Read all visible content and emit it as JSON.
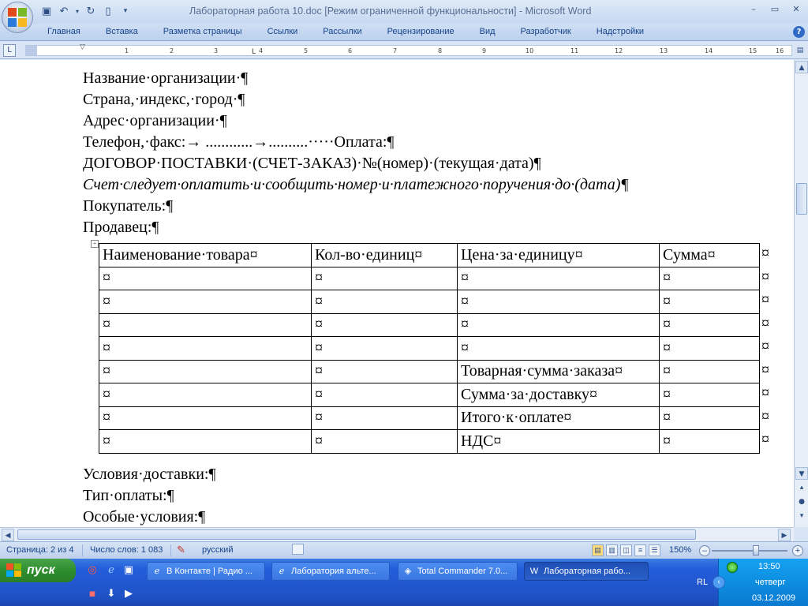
{
  "window": {
    "title": "Лабораторная работа 10.doc [Режим ограниченной функциональности]  -  Microsoft Word",
    "minimize": "–",
    "restore": "▭",
    "close": "✕"
  },
  "ribbon": {
    "tabs": [
      "Главная",
      "Вставка",
      "Разметка страницы",
      "Ссылки",
      "Рассылки",
      "Рецензирование",
      "Вид",
      "Разработчик",
      "Надстройки"
    ],
    "help": "?"
  },
  "ruler": {
    "numbers": [
      "1",
      "2",
      "3",
      "4",
      "5",
      "6",
      "7",
      "8",
      "9",
      "10",
      "11",
      "12",
      "13",
      "14",
      "15",
      "16"
    ]
  },
  "document": {
    "lines": [
      "Название·организации·¶",
      "Страна,·индекс,·город·¶",
      "Адрес·организации·¶",
      "Телефон,·факс:→ ............→..........·····Оплата:¶",
      "ДОГОВОР·ПОСТАВКИ·(СЧЕТ-ЗАКАЗ)·№(номер)·(текущая·дата)¶",
      "Счет·следует·оплатить·и·сообщить·номер·и·платежного·поручения·до·(дата)¶",
      "Покупатель:¶",
      "Продавец:¶"
    ],
    "table": {
      "header": [
        "Наименование·товара¤",
        "Кол-во·единиц¤",
        "Цена·за·единицу¤",
        "Сумма¤"
      ],
      "rows": [
        [
          "¤",
          "¤",
          "¤",
          "¤"
        ],
        [
          "¤",
          "¤",
          "¤",
          "¤"
        ],
        [
          "¤",
          "¤",
          "¤",
          "¤"
        ],
        [
          "¤",
          "¤",
          "¤",
          "¤"
        ],
        [
          "¤",
          "¤",
          "Товарная·сумма·заказа¤",
          "¤"
        ],
        [
          "¤",
          "¤",
          "Сумма·за·доставку¤",
          "¤"
        ],
        [
          "¤",
          "¤",
          "Итого·к·оплате¤",
          "¤"
        ],
        [
          "¤",
          "¤",
          "НДС¤",
          "¤"
        ]
      ],
      "row_end_mark": "¤"
    },
    "after_lines": [
      "Условия·доставки:¶",
      "Тип·оплаты:¶",
      "Особые·условия:¶",
      "¶"
    ]
  },
  "statusbar": {
    "page": "Страница: 2 из 4",
    "words": "Число слов: 1 083",
    "language": "русский",
    "zoom": "150%"
  },
  "taskbar": {
    "start": "пуск",
    "buttons": [
      {
        "label": "В Контакте | Радио ...",
        "icon": "ie-icon"
      },
      {
        "label": "Лаборатория альте...",
        "icon": "ie-icon"
      },
      {
        "label": "Total Commander 7.0...",
        "icon": "total-commander-icon"
      },
      {
        "label": "Лабораторная рабо...",
        "icon": "word-icon"
      }
    ],
    "tray": {
      "lang": "RL",
      "time": "13:50",
      "day": "четверг",
      "date": "03.12.2009"
    }
  }
}
